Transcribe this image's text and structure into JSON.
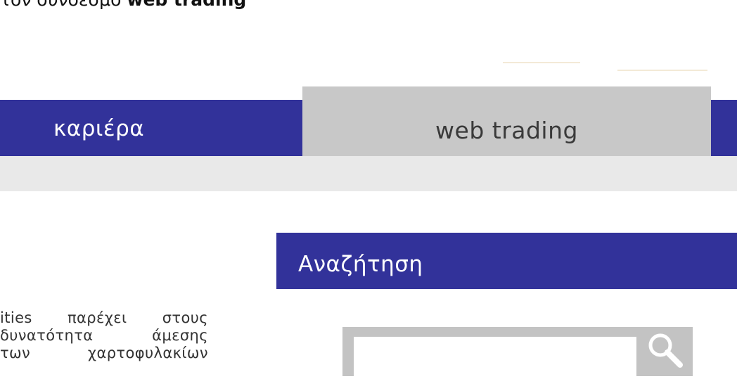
{
  "top_banner": {
    "text_prefix": "τον σύνδεσμο ",
    "text_bold": "web trading"
  },
  "navigation": {
    "items": [
      {
        "label": "καριέρα"
      },
      {
        "label": "web trading",
        "active": true
      }
    ],
    "colors": {
      "bar": "#32329a",
      "active_tab": "#c8c8c8"
    }
  },
  "search": {
    "title": "Αναζήτηση",
    "input_value": "",
    "button_icon": "magnifier-icon"
  },
  "intro_paragraph": {
    "lines": [
      "ities παρέχει στους",
      "δυνατότητα άμεσης",
      "των χαρτοφυλακίων"
    ]
  }
}
